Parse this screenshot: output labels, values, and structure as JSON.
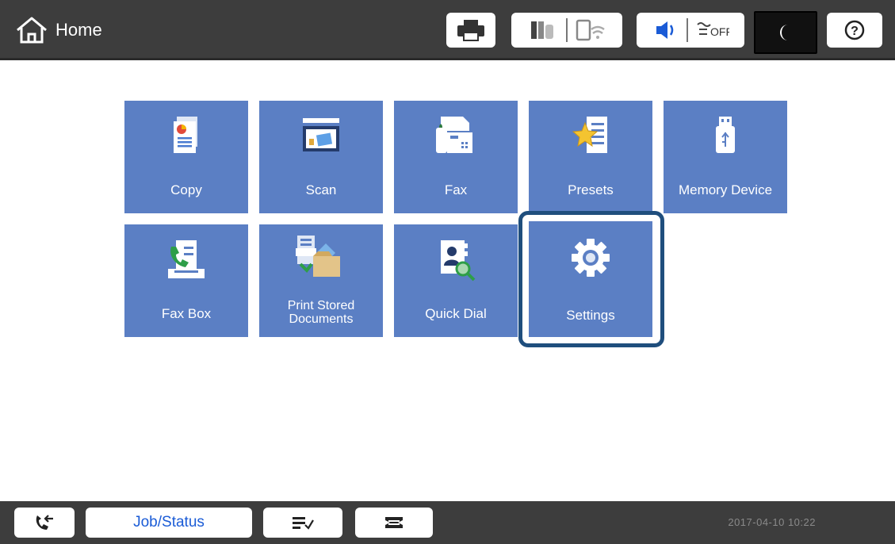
{
  "header": {
    "title": "Home",
    "icons": [
      "home-icon",
      "printer-icon",
      "ink-cartridge-icon",
      "network-wifi-icon",
      "volume-icon",
      "quiet-mode-off-icon",
      "sleep-moon-icon",
      "help-icon"
    ]
  },
  "tiles": [
    {
      "label": "Copy",
      "icon": "copy-icon"
    },
    {
      "label": "Scan",
      "icon": "scan-icon"
    },
    {
      "label": "Fax",
      "icon": "fax-icon"
    },
    {
      "label": "Presets",
      "icon": "presets-icon"
    },
    {
      "label": "Memory Device",
      "icon": "memory-device-icon"
    },
    {
      "label": "Fax Box",
      "icon": "fax-box-icon"
    },
    {
      "label_line1": "Print Stored",
      "label_line2": "Documents",
      "icon": "print-stored-documents-icon"
    },
    {
      "label": "Quick Dial",
      "icon": "quick-dial-icon"
    },
    {
      "label": "Settings",
      "icon": "settings-gear-icon",
      "highlighted": true
    }
  ],
  "footer": {
    "job_status_label": "Job/Status",
    "datetime": "2017-04-10 10:22",
    "icons": [
      "fax-line-icon",
      "job-list-icon",
      "paper-tray-icon"
    ]
  },
  "colors": {
    "tile": "#5b7fc4",
    "bar": "#3d3d3d",
    "highlight": "#1f4e7d",
    "link": "#1a5bd6"
  }
}
